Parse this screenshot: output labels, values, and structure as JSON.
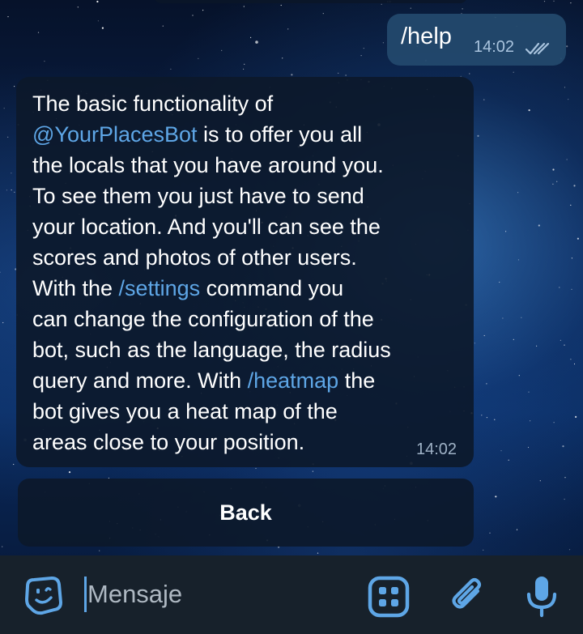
{
  "chat": {
    "outgoing": {
      "text": "/help",
      "time": "14:02",
      "status_icon": "double-check-icon"
    },
    "incoming": {
      "lines": [
        [
          {
            "text": "The basic functionality of",
            "link": false
          }
        ],
        [
          {
            "text": "@YourPlacesBot",
            "link": true
          },
          {
            "text": " is to offer you all",
            "link": false
          }
        ],
        [
          {
            "text": "the locals that you have around you.",
            "link": false
          }
        ],
        [
          {
            "text": "To see them you just have to send",
            "link": false
          }
        ],
        [
          {
            "text": "your location. And you'll can see the",
            "link": false
          }
        ],
        [
          {
            "text": "scores and photos of other users.",
            "link": false
          }
        ],
        [
          {
            "text": "With the ",
            "link": false
          },
          {
            "text": "/settings",
            "link": true
          },
          {
            "text": " command you",
            "link": false
          }
        ],
        [
          {
            "text": "can change the configuration of the",
            "link": false
          }
        ],
        [
          {
            "text": "bot, such as the language, the radius",
            "link": false
          }
        ],
        [
          {
            "text": "query and more. With ",
            "link": false
          },
          {
            "text": "/heatmap",
            "link": true
          },
          {
            "text": " the",
            "link": false
          }
        ],
        [
          {
            "text": "bot gives you a heat map of the",
            "link": false
          }
        ],
        [
          {
            "text": "areas close to your position.",
            "link": false
          }
        ]
      ],
      "time": "14:02"
    },
    "inline_button": {
      "label": "Back"
    }
  },
  "composer": {
    "placeholder": "Mensaje",
    "icons": {
      "sticker": "sticker-icon",
      "commands": "bot-commands-icon",
      "attach": "paperclip-icon",
      "mic": "microphone-icon"
    }
  },
  "colors": {
    "accent": "#5ea6e6",
    "link": "#5ea6e6",
    "bubble_out": "#244a6e",
    "bubble_in": "#0c182a",
    "composer_bg": "#17212b"
  }
}
